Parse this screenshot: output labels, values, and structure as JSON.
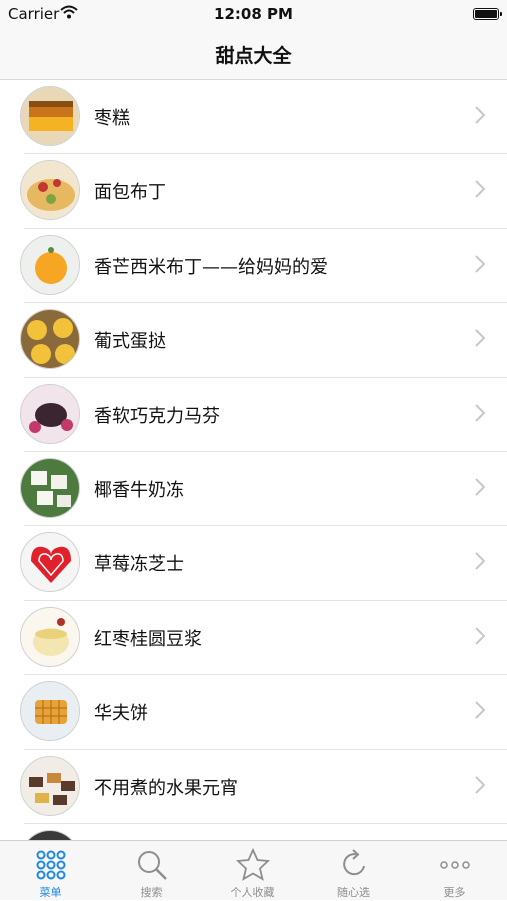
{
  "status_bar": {
    "carrier": "Carrier",
    "time": "12:08 PM"
  },
  "nav": {
    "title": "甜点大全"
  },
  "recipes": [
    {
      "name": "枣糕",
      "thumb": "jujube-cake-image"
    },
    {
      "name": "面包布丁",
      "thumb": "bread-pudding-image"
    },
    {
      "name": "香芒西米布丁——给妈妈的爱",
      "thumb": "mango-sago-pudding-image"
    },
    {
      "name": "葡式蛋挞",
      "thumb": "egg-tart-image"
    },
    {
      "name": "香软巧克力马芬",
      "thumb": "chocolate-muffin-image"
    },
    {
      "name": "椰香牛奶冻",
      "thumb": "coconut-milk-jelly-image"
    },
    {
      "name": "草莓冻芝士",
      "thumb": "strawberry-cheesecake-image"
    },
    {
      "name": "红枣桂圆豆浆",
      "thumb": "jujube-soymilk-image"
    },
    {
      "name": "华夫饼",
      "thumb": "waffle-image"
    },
    {
      "name": "不用煮的水果元宵",
      "thumb": "fruit-yuanxiao-image"
    },
    {
      "name": "",
      "thumb": "partial-item-image"
    }
  ],
  "tabs": [
    {
      "label": "菜单",
      "icon": "grid-icon",
      "active": true
    },
    {
      "label": "搜索",
      "icon": "search-icon",
      "active": false
    },
    {
      "label": "个人收藏",
      "icon": "star-icon",
      "active": false
    },
    {
      "label": "随心选",
      "icon": "refresh-icon",
      "active": false
    },
    {
      "label": "更多",
      "icon": "more-icon",
      "active": false
    }
  ],
  "colors": {
    "accent": "#1e88e5",
    "inactive": "#8e8e8e"
  }
}
